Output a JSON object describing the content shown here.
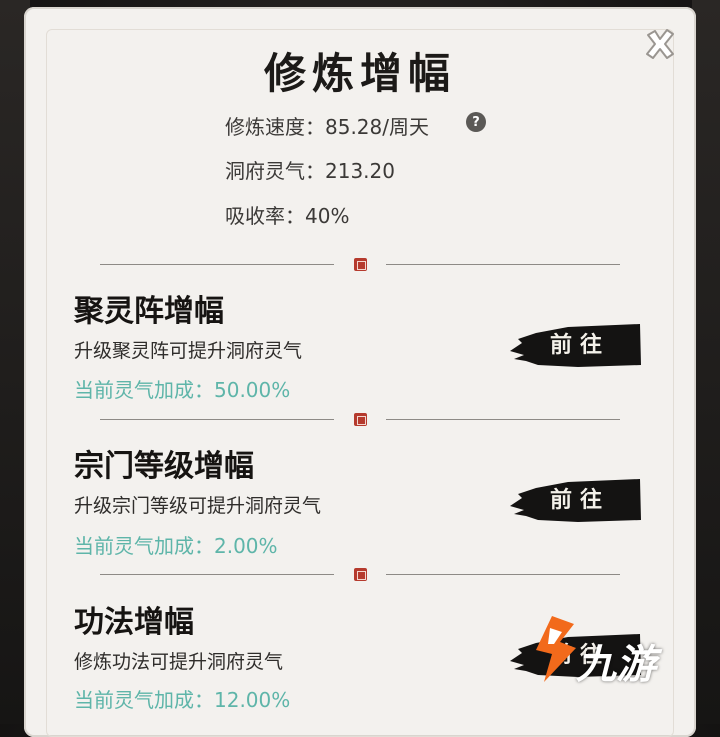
{
  "dialog": {
    "title": "修炼增幅",
    "stats": [
      {
        "label": "修炼速度：85.28/周天"
      },
      {
        "label": "洞府灵气：213.20"
      },
      {
        "label": "吸收率：40%"
      }
    ],
    "help_label": "?"
  },
  "sections": [
    {
      "title": "聚灵阵增幅",
      "desc": "升级聚灵阵可提升洞府灵气",
      "bonus": "当前灵气加成：50.00%",
      "button": "前往"
    },
    {
      "title": "宗门等级增幅",
      "desc": "升级宗门等级可提升洞府灵气",
      "bonus": "当前灵气加成：2.00%",
      "button": "前往"
    },
    {
      "title": "功法增幅",
      "desc": "修炼功法可提升洞府灵气",
      "bonus": "当前灵气加成：12.00%",
      "button": "前往"
    }
  ],
  "watermark": {
    "text": "九游"
  },
  "colors": {
    "accent_bonus": "#5eb5a9",
    "panel_bg": "#f3f1ee",
    "seal_red": "#b53a2d",
    "button_ink": "#141312"
  }
}
